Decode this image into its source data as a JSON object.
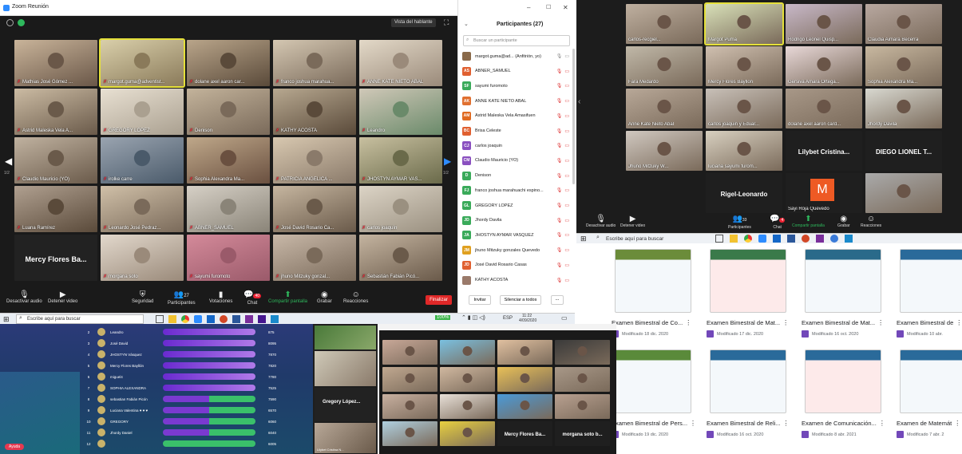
{
  "zoom_main": {
    "window_title": "Zoom Reunión",
    "view_button": "Vista del hablante",
    "page_left": "1/2",
    "page_right": "1/2",
    "tiles": [
      "Mathias José Gómez ...",
      "margot.guma@adventist...",
      "dolane axel aaron car...",
      "franco joshua marahua...",
      "ANNE KATE NIETO ABAL",
      "Astrid Maleska Vela A...",
      "GREGORY LÓPEZ",
      "Denison",
      "KATHY ACOSTA",
      "Leandro",
      "Claudio Mauricio (YO)",
      "irolke carre",
      "Sophia Alexandra Ma...",
      "PATRICIA ANGELICA ...",
      "JHOSTYN AYMAR VAS...",
      "Luana Ramírez",
      "Leonardo José Pedraz...",
      "ABNER_SAMUEL",
      "José David Rosario Ca...",
      "carlos joaquín",
      "Mercy Flores Ba...",
      "morgana soto",
      "sayumi furomoto",
      "jhuno Mitzuky gonzal...",
      "Sebastián Fabián Picó..."
    ],
    "toolbar": {
      "audio": "Desactivar audio",
      "video": "Detener video",
      "security": "Seguridad",
      "participants": "Participantes",
      "participants_count": "27",
      "polls": "Votaciones",
      "chat": "Chat",
      "chat_badge": "40",
      "share": "Compartir pantalla",
      "record": "Grabar",
      "reactions": "Reacciones",
      "end": "Finalizar"
    }
  },
  "participants_panel": {
    "title": "Participantes (27)",
    "search_placeholder": "Buscar un participante",
    "people": [
      {
        "initials": "",
        "name": "margot.guma@ad... (Anfitrión, yo)",
        "color": "#8a6a4a"
      },
      {
        "initials": "AS",
        "name": "ABNER_SAMUEL",
        "color": "#e06030"
      },
      {
        "initials": "SF",
        "name": "sayumi furomoto",
        "color": "#3aaa5a"
      },
      {
        "initials": "AK",
        "name": "ANNE KATE NIETO ABAL",
        "color": "#e07030"
      },
      {
        "initials": "AM",
        "name": "Astrid Maleska Vela Amasifuen",
        "color": "#e06a20"
      },
      {
        "initials": "BC",
        "name": "Brisa Celeste",
        "color": "#e06030"
      },
      {
        "initials": "CJ",
        "name": "carlos joaquin",
        "color": "#8a50c0"
      },
      {
        "initials": "CM",
        "name": "Claudio Mauricio (YO)",
        "color": "#8a50c0"
      },
      {
        "initials": "D",
        "name": "Denison",
        "color": "#3aaa5a"
      },
      {
        "initials": "FJ",
        "name": "franco joshua marahuachi espino...",
        "color": "#3aaa5a"
      },
      {
        "initials": "GL",
        "name": "GREGORY LOPEZ",
        "color": "#3aaa5a"
      },
      {
        "initials": "JD",
        "name": "Jhordy Davila",
        "color": "#3aaa5a"
      },
      {
        "initials": "JA",
        "name": "JHOSTYN AYMAR VASQUEZ",
        "color": "#3aaa5a"
      },
      {
        "initials": "JM",
        "name": "jhuno Mitzuky gonzales Quevedo",
        "color": "#e0a020"
      },
      {
        "initials": "JD",
        "name": "José David Rosario Casas",
        "color": "#e06030"
      },
      {
        "initials": "",
        "name": "KATHY ACOSTA",
        "color": "#9a7a6a"
      }
    ],
    "invite": "Invitar",
    "mute_all": "Silenciar a todos",
    "more": "..."
  },
  "taskbar_main": {
    "search": "Escribe aquí para buscar",
    "battery": "100%",
    "lang": "ESP",
    "time": "11:22",
    "date": "4/09/2020"
  },
  "zoom_top_right": {
    "tiles": [
      "carlos-recgiel...",
      "Margot Puma",
      "Rodrigo Leonel Quisp...",
      "Claudia Aimara Becerra",
      "",
      "Fara Medardo",
      "Mercy Flores Bayllon",
      "Gersiva Amara Ortega...",
      "Sophia Alexandra Ma...",
      "",
      "Anne Kate Nieto Abal",
      "carlos joaquin y Eduar...",
      "dolane axel aaron card...",
      "Jhordy Davila",
      "",
      "Jhuno Mitzuky W...",
      "luciana sayumi furom...",
      "Lilybet  Cristina...",
      "DIEGO LIONEL T...",
      "",
      "",
      "Rigel-Leonardo",
      "Sayi Roja Quevedo",
      ""
    ],
    "toolbar": {
      "audio": "Desactivar audio",
      "video": "Detener video",
      "participants": "Participantes",
      "participants_count": "33",
      "chat": "Chat",
      "chat_badge": "4",
      "share": "Compartir pantalla",
      "record": "Grabar",
      "reactions": "Reacciones"
    },
    "avatar_letter": "M"
  },
  "taskbar_right": {
    "search": "Escribe aquí para buscar"
  },
  "forms": [
    {
      "title": "Examen Bimestral de Co...",
      "modified": "Modificado 18 dic. 2020",
      "accent": "#6b8c3a"
    },
    {
      "title": "Examen Bimestral de Mat...",
      "modified": "Modificado 17 dic. 2020",
      "accent": "#3a7a4a"
    },
    {
      "title": "Examen Bimestral de Mat...",
      "modified": "Modificado 16 oct. 2020",
      "accent": "#2a6a8a"
    },
    {
      "title": "Examen Bimestral de",
      "modified": "Modificado 10 abr.",
      "accent": "#2a6a9a"
    },
    {
      "title": "Examen Bimestral de Pers...",
      "modified": "Modificado 19 dic. 2020",
      "accent": "#5a8a3a"
    },
    {
      "title": "Examen Bimestral de Reli...",
      "modified": "Modificado 16 oct. 2020",
      "accent": "#2a6a9a"
    },
    {
      "title": "Examen de Comunicación...",
      "modified": "Modificado 8 abr. 2021",
      "accent": "#2a6a9a"
    },
    {
      "title": "Examen de Matemát",
      "modified": "Modificado 7 abr. 2",
      "accent": "#2a6a9a"
    }
  ],
  "kahoot": {
    "rows": [
      {
        "rank": "2",
        "name": "Leandro",
        "score": "875"
      },
      {
        "rank": "3",
        "name": "José David",
        "score": "8095"
      },
      {
        "rank": "4",
        "name": "JHOSTYN Vásquez",
        "score": "7870"
      },
      {
        "rank": "5",
        "name": "Mercy Flores Bayllón",
        "score": "7820"
      },
      {
        "rank": "6",
        "name": "miguel4",
        "score": "7780"
      },
      {
        "rank": "7",
        "name": "SOPHIA ALEXANDRA",
        "score": "7525"
      },
      {
        "rank": "8",
        "name": "sebastian Fabián Picón",
        "score": "7590"
      },
      {
        "rank": "9",
        "name": "Luciana Valentina ♥ ♥ ♥",
        "score": "6570"
      },
      {
        "rank": "10",
        "name": "GREGORY",
        "score": "6060"
      },
      {
        "rank": "11",
        "name": "Jhordy Daniel",
        "score": "6040"
      },
      {
        "rank": "12",
        "name": "",
        "score": "6005"
      }
    ],
    "side_label": "Gregory López...",
    "side_label2": "Lilybet Cristina N...",
    "exit": "Ayuda"
  },
  "zoom_bottom_mid": {
    "tiles": [
      "",
      "",
      "",
      "",
      "",
      "",
      "",
      "",
      "",
      "",
      "",
      "",
      "",
      "",
      "",
      "",
      "",
      "Mercy Flores Ba...",
      "morgana soto b..."
    ]
  }
}
